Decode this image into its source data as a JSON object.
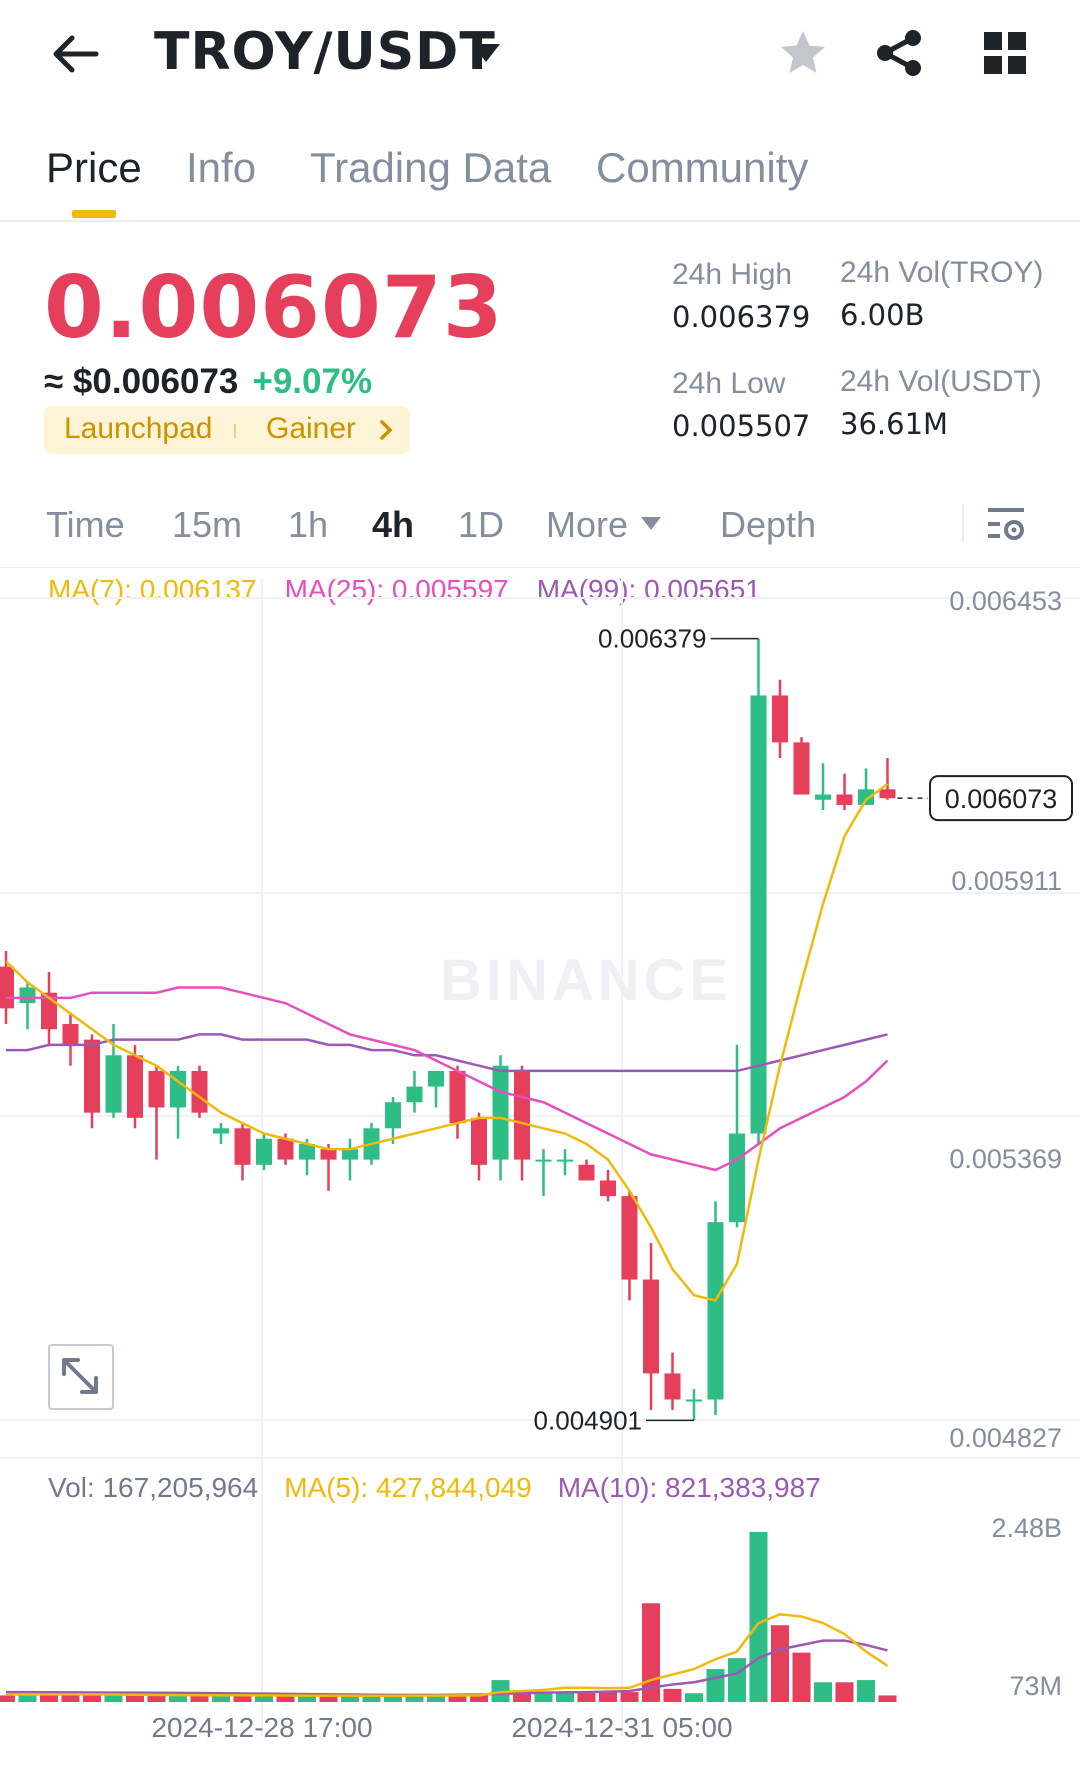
{
  "header": {
    "pair": "TROY/USDT",
    "icons": [
      "back-arrow-icon",
      "chevron-down-icon",
      "star-icon",
      "share-icon",
      "grid-icon"
    ]
  },
  "tabs": [
    {
      "label": "Price",
      "active": true
    },
    {
      "label": "Info",
      "active": false
    },
    {
      "label": "Trading Data",
      "active": false
    },
    {
      "label": "Community",
      "active": false
    }
  ],
  "price": {
    "last": "0.006073",
    "usd": "≈ $0.006073",
    "change": "+9.07%",
    "tags": [
      "Launchpad",
      "Gainer"
    ],
    "colors": {
      "down": "#e63f5b",
      "up": "#2ebd85",
      "tag": "#c99400"
    }
  },
  "stats": {
    "high_label": "24h High",
    "high_value": "0.006379",
    "low_label": "24h Low",
    "low_value": "0.005507",
    "vol_troy_label": "24h Vol(TROY)",
    "vol_troy_value": "6.00B",
    "vol_usdt_label": "24h Vol(USDT)",
    "vol_usdt_value": "36.61M"
  },
  "intervals": {
    "items": [
      "Time",
      "15m",
      "1h",
      "4h",
      "1D",
      "More"
    ],
    "active": "4h",
    "depth": "Depth"
  },
  "ma_legend": {
    "ma7": "MA(7): 0.006137",
    "ma25": "MA(25): 0.005597",
    "ma99": "MA(99): 0.005651"
  },
  "vol_legend": {
    "vol": "Vol: 167,205,964",
    "ma5": "MA(5): 427,844,049",
    "ma10": "MA(10): 821,383,987"
  },
  "chart_data": {
    "type": "candlestick",
    "interval": "4h",
    "price_axis_ticks": [
      "0.006453",
      "0.005911",
      "0.005369",
      "0.004827"
    ],
    "volume_axis_ticks": [
      "2.48B",
      "73M"
    ],
    "x_ticks": [
      "2024-12-28 17:00",
      "2024-12-31 05:00"
    ],
    "current_price_label": "0.006073",
    "high_marker": "0.006379",
    "low_marker": "0.004901",
    "watermark": "BINANCE",
    "ylim": [
      0.004827,
      0.006453
    ],
    "candles": [
      {
        "o": 0.00575,
        "h": 0.00578,
        "l": 0.00564,
        "c": 0.00567
      },
      {
        "o": 0.00568,
        "h": 0.00572,
        "l": 0.00563,
        "c": 0.00571
      },
      {
        "o": 0.0057,
        "h": 0.00574,
        "l": 0.0056,
        "c": 0.00563
      },
      {
        "o": 0.00564,
        "h": 0.00566,
        "l": 0.00556,
        "c": 0.0056
      },
      {
        "o": 0.00561,
        "h": 0.00562,
        "l": 0.00544,
        "c": 0.00547
      },
      {
        "o": 0.00547,
        "h": 0.00564,
        "l": 0.00546,
        "c": 0.00558
      },
      {
        "o": 0.00558,
        "h": 0.0056,
        "l": 0.00544,
        "c": 0.00546
      },
      {
        "o": 0.00555,
        "h": 0.00556,
        "l": 0.00538,
        "c": 0.00548
      },
      {
        "o": 0.00548,
        "h": 0.00556,
        "l": 0.00542,
        "c": 0.00555
      },
      {
        "o": 0.00555,
        "h": 0.00556,
        "l": 0.00546,
        "c": 0.00547
      },
      {
        "o": 0.00543,
        "h": 0.00545,
        "l": 0.00541,
        "c": 0.00544
      },
      {
        "o": 0.00544,
        "h": 0.00545,
        "l": 0.00534,
        "c": 0.00537
      },
      {
        "o": 0.00537,
        "h": 0.00543,
        "l": 0.00536,
        "c": 0.00542
      },
      {
        "o": 0.00542,
        "h": 0.00543,
        "l": 0.00537,
        "c": 0.00538
      },
      {
        "o": 0.00538,
        "h": 0.00542,
        "l": 0.00535,
        "c": 0.00541
      },
      {
        "o": 0.0054,
        "h": 0.00541,
        "l": 0.00532,
        "c": 0.00538
      },
      {
        "o": 0.00538,
        "h": 0.00542,
        "l": 0.00534,
        "c": 0.0054
      },
      {
        "o": 0.00538,
        "h": 0.00545,
        "l": 0.00537,
        "c": 0.00544
      },
      {
        "o": 0.00544,
        "h": 0.0055,
        "l": 0.00541,
        "c": 0.00549
      },
      {
        "o": 0.00549,
        "h": 0.00555,
        "l": 0.00547,
        "c": 0.00552
      },
      {
        "o": 0.00552,
        "h": 0.00555,
        "l": 0.00548,
        "c": 0.00555
      },
      {
        "o": 0.00555,
        "h": 0.00556,
        "l": 0.00542,
        "c": 0.00545
      },
      {
        "o": 0.00546,
        "h": 0.00547,
        "l": 0.00534,
        "c": 0.00537
      },
      {
        "o": 0.00538,
        "h": 0.00558,
        "l": 0.00534,
        "c": 0.00556
      },
      {
        "o": 0.00555,
        "h": 0.00556,
        "l": 0.00534,
        "c": 0.00538
      },
      {
        "o": 0.00538,
        "h": 0.0054,
        "l": 0.00531,
        "c": 0.00538
      },
      {
        "o": 0.00538,
        "h": 0.0054,
        "l": 0.00535,
        "c": 0.00538
      },
      {
        "o": 0.00537,
        "h": 0.00538,
        "l": 0.00534,
        "c": 0.00534
      },
      {
        "o": 0.00534,
        "h": 0.00536,
        "l": 0.0053,
        "c": 0.00531
      },
      {
        "o": 0.00531,
        "h": 0.00532,
        "l": 0.00511,
        "c": 0.00515
      },
      {
        "o": 0.00515,
        "h": 0.00522,
        "l": 0.0049,
        "c": 0.00497
      },
      {
        "o": 0.00497,
        "h": 0.00501,
        "l": 0.0049,
        "c": 0.00492
      },
      {
        "o": 0.00492,
        "h": 0.00494,
        "l": 0.00488,
        "c": 0.00492
      },
      {
        "o": 0.00492,
        "h": 0.0053,
        "l": 0.00489,
        "c": 0.00526
      },
      {
        "o": 0.00526,
        "h": 0.0056,
        "l": 0.00525,
        "c": 0.00543
      },
      {
        "o": 0.00543,
        "h": 0.006379,
        "l": 0.00541,
        "c": 0.00627
      },
      {
        "o": 0.00627,
        "h": 0.0063,
        "l": 0.00615,
        "c": 0.00618
      },
      {
        "o": 0.00618,
        "h": 0.00619,
        "l": 0.00608,
        "c": 0.00608
      },
      {
        "o": 0.00607,
        "h": 0.00614,
        "l": 0.00605,
        "c": 0.00608
      },
      {
        "o": 0.00608,
        "h": 0.00612,
        "l": 0.00605,
        "c": 0.00606
      },
      {
        "o": 0.00606,
        "h": 0.00613,
        "l": 0.00606,
        "c": 0.00609
      },
      {
        "o": 0.00609,
        "h": 0.00615,
        "l": 0.00607,
        "c": 0.006073
      }
    ],
    "ma7": [
      0.00576,
      0.00572,
      0.00569,
      0.00566,
      0.00563,
      0.0056,
      0.00558,
      0.00556,
      0.00553,
      0.0055,
      0.00547,
      0.00545,
      0.00543,
      0.00542,
      0.00541,
      0.0054,
      0.0054,
      0.00541,
      0.00542,
      0.00543,
      0.00544,
      0.00545,
      0.00546,
      0.00546,
      0.00545,
      0.00544,
      0.00543,
      0.00541,
      0.00538,
      0.00532,
      0.00525,
      0.00517,
      0.00512,
      0.00511,
      0.00518,
      0.00538,
      0.00556,
      0.00572,
      0.00587,
      0.006,
      0.00607,
      0.0061
    ],
    "ma25": [
      0.00569,
      0.00569,
      0.00569,
      0.00569,
      0.0057,
      0.0057,
      0.0057,
      0.0057,
      0.00571,
      0.00571,
      0.00571,
      0.0057,
      0.00569,
      0.00568,
      0.00566,
      0.00564,
      0.00562,
      0.00561,
      0.0056,
      0.00559,
      0.00557,
      0.00555,
      0.00553,
      0.00551,
      0.0055,
      0.00549,
      0.00547,
      0.00545,
      0.00543,
      0.00541,
      0.00539,
      0.00538,
      0.00537,
      0.00536,
      0.00538,
      0.00541,
      0.00544,
      0.00546,
      0.00548,
      0.0055,
      0.00553,
      0.00557
    ],
    "ma99": [
      0.00559,
      0.00559,
      0.0056,
      0.0056,
      0.0056,
      0.00561,
      0.00561,
      0.00561,
      0.00561,
      0.00562,
      0.00562,
      0.00561,
      0.00561,
      0.00561,
      0.00561,
      0.0056,
      0.0056,
      0.00559,
      0.00559,
      0.00558,
      0.00558,
      0.00557,
      0.00556,
      0.00555,
      0.00555,
      0.00555,
      0.00555,
      0.00555,
      0.00555,
      0.00555,
      0.00555,
      0.00555,
      0.00555,
      0.00555,
      0.00555,
      0.00556,
      0.00557,
      0.00558,
      0.00559,
      0.0056,
      0.00561,
      0.00562
    ],
    "volume": [
      60,
      60,
      65,
      70,
      65,
      70,
      60,
      60,
      65,
      65,
      55,
      60,
      60,
      55,
      55,
      60,
      55,
      55,
      55,
      60,
      60,
      65,
      70,
      200,
      100,
      90,
      80,
      80,
      90,
      90,
      900,
      120,
      80,
      300,
      400,
      1550,
      700,
      450,
      180,
      180,
      200,
      60
    ],
    "vol_ma5": [
      68,
      68,
      69,
      70,
      69,
      68,
      66,
      64,
      63,
      62,
      61,
      61,
      60,
      59,
      58,
      58,
      57,
      57,
      57,
      58,
      58,
      59,
      60,
      90,
      100,
      110,
      130,
      130,
      125,
      130,
      200,
      250,
      300,
      390,
      460,
      720,
      800,
      780,
      720,
      620,
      460,
      330
    ],
    "vol_ma10": [
      90,
      90,
      89,
      88,
      87,
      86,
      85,
      84,
      83,
      82,
      80,
      78,
      76,
      74,
      72,
      70,
      68,
      66,
      65,
      65,
      65,
      66,
      68,
      75,
      80,
      85,
      88,
      90,
      95,
      100,
      130,
      160,
      180,
      220,
      260,
      400,
      480,
      520,
      560,
      560,
      520,
      470
    ]
  }
}
